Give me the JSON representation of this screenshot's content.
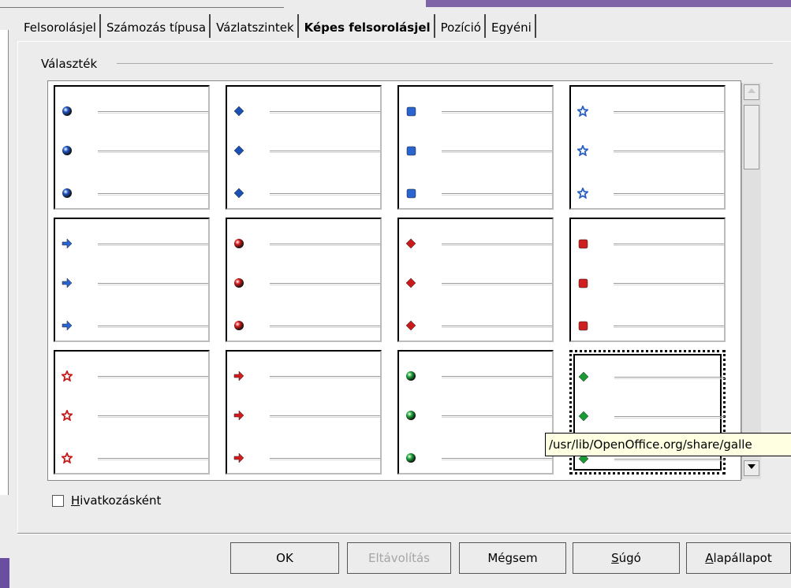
{
  "tabs": [
    "Felsorolásjel",
    "Számozás típusa",
    "Vázlatszintek",
    "Képes felsorolásjel",
    "Pozíció",
    "Egyéni"
  ],
  "active_tab": "Képes felsorolásjel",
  "section_label": "Választék",
  "gallery": [
    {
      "shape": "sphere",
      "color": "#1f56c4"
    },
    {
      "shape": "diamond",
      "color": "#1a4fb4"
    },
    {
      "shape": "square",
      "color": "#2a64d0"
    },
    {
      "shape": "star",
      "color": "#2a5ec8"
    },
    {
      "shape": "arrow",
      "color": "#2a64d0"
    },
    {
      "shape": "sphere",
      "color": "#d41b1b"
    },
    {
      "shape": "diamond",
      "color": "#c81a1a"
    },
    {
      "shape": "square",
      "color": "#d01f1f"
    },
    {
      "shape": "star",
      "color": "#c81a1a"
    },
    {
      "shape": "arrow",
      "color": "#d41b1b"
    },
    {
      "shape": "sphere",
      "color": "#1fa83a"
    },
    {
      "shape": "diamond",
      "color": "#1a9a33"
    }
  ],
  "tooltip": "/usr/lib/OpenOffice.org/share/galle",
  "link_checkbox": {
    "label_first": "H",
    "label_rest": "ivatkozásként",
    "checked": false
  },
  "buttons": {
    "ok": "OK",
    "remove": "Eltávolítás",
    "cancel": "Mégsem",
    "help_first": "S",
    "help_rest": "úgó",
    "reset_first": "A",
    "reset_rest": "lapállapot"
  }
}
